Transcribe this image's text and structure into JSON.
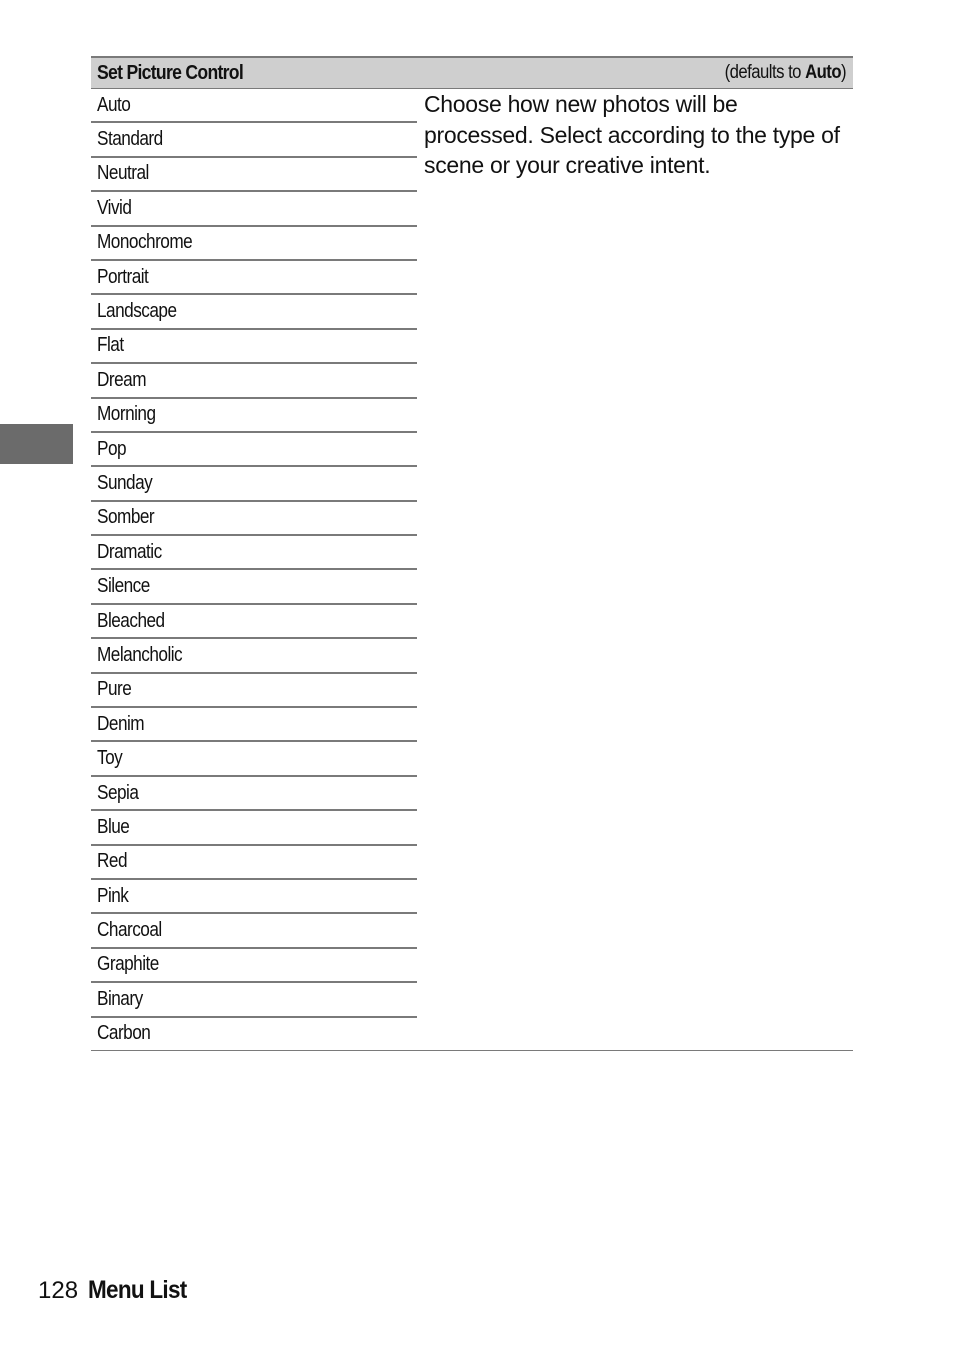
{
  "header": {
    "title": "Set Picture Control",
    "default_prefix": "(defaults to ",
    "default_value": "Auto",
    "default_suffix": ")"
  },
  "options": [
    "Auto",
    "Standard",
    "Neutral",
    "Vivid",
    "Monochrome",
    "Portrait",
    "Landscape",
    "Flat",
    "Dream",
    "Morning",
    "Pop",
    "Sunday",
    "Somber",
    "Dramatic",
    "Silence",
    "Bleached",
    "Melancholic",
    "Pure",
    "Denim",
    "Toy",
    "Sepia",
    "Blue",
    "Red",
    "Pink",
    "Charcoal",
    "Graphite",
    "Binary",
    "Carbon"
  ],
  "description": "Choose how new photos will be processed. Select according to the type of scene or your creative intent.",
  "footer": {
    "page_number": "128",
    "section": "Menu List"
  }
}
